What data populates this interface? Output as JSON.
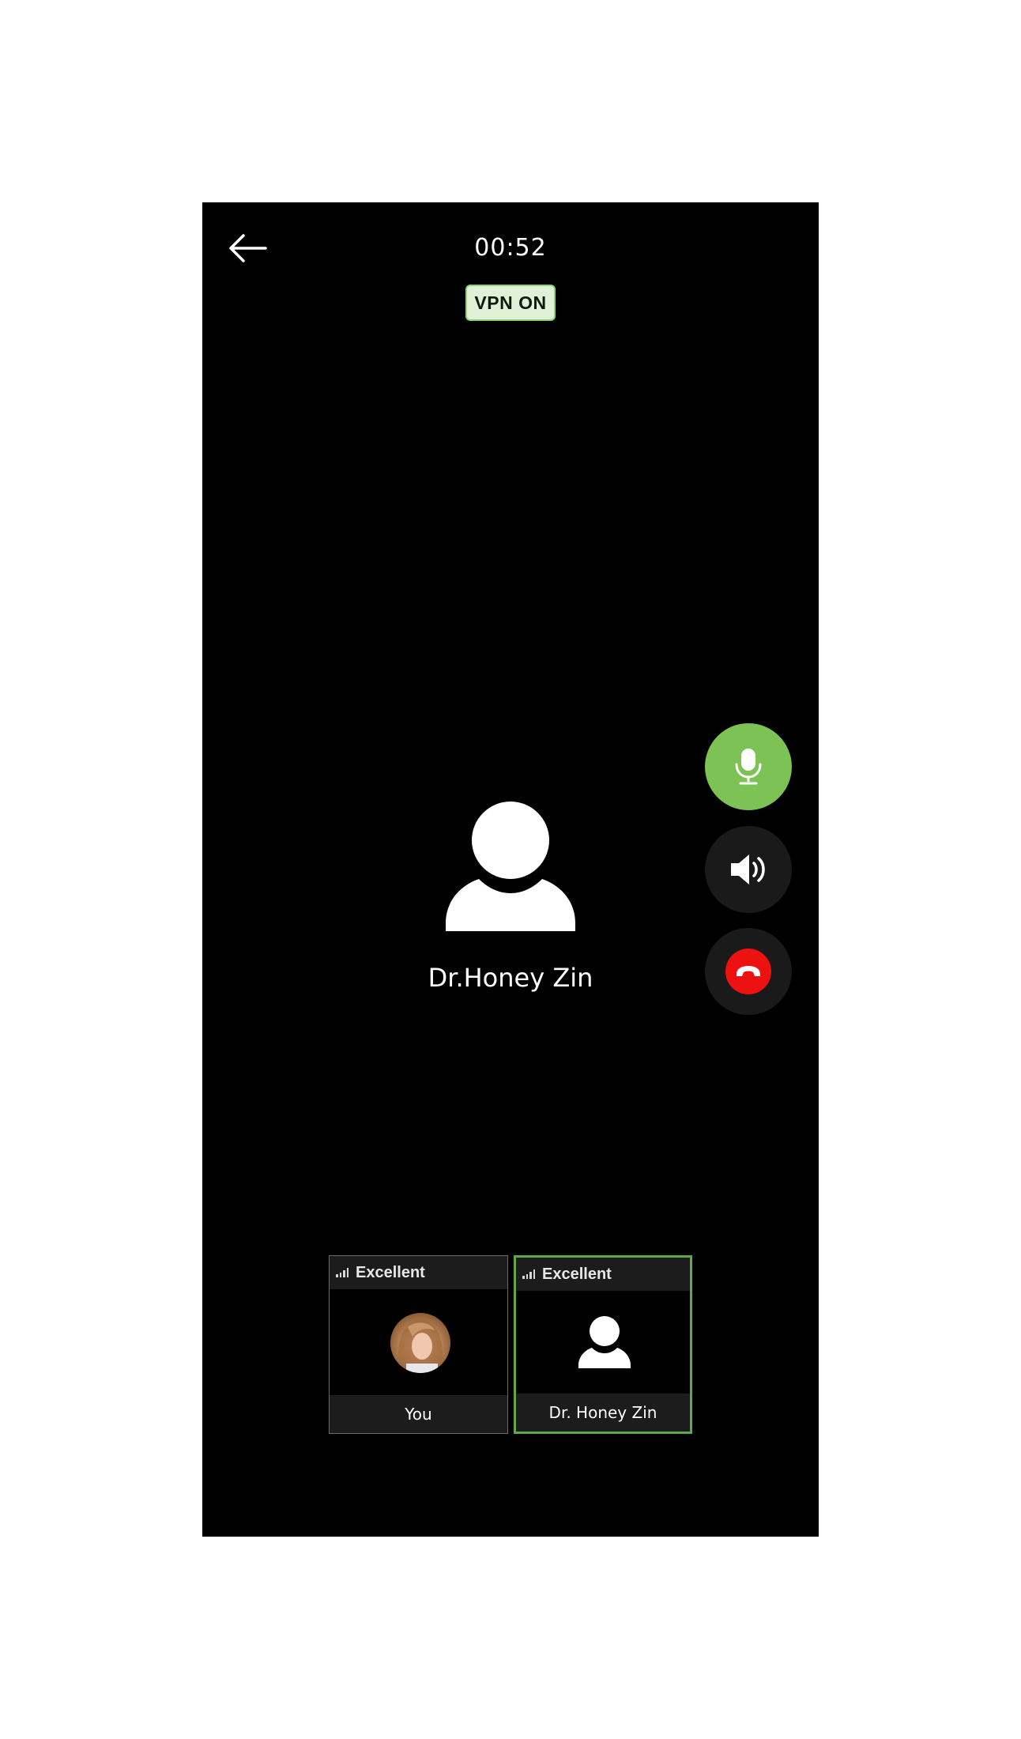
{
  "call": {
    "timer": "00:52",
    "vpn_status": "VPN ON",
    "caller_name": "Dr.Honey Zin"
  },
  "controls": {
    "mic": {
      "icon": "microphone-icon",
      "color": "#7cc254",
      "active": true
    },
    "speaker": {
      "icon": "speaker-icon",
      "color": "#1a1a1a"
    },
    "end_call": {
      "icon": "hang-up-icon",
      "color": "#ee1111"
    }
  },
  "participants": [
    {
      "label": "You",
      "quality": "Excellent",
      "avatar": "user-photo",
      "active": false
    },
    {
      "label": "Dr. Honey Zin",
      "quality": "Excellent",
      "avatar": "person-icon",
      "active": true,
      "accent": "#5ea846"
    }
  ]
}
